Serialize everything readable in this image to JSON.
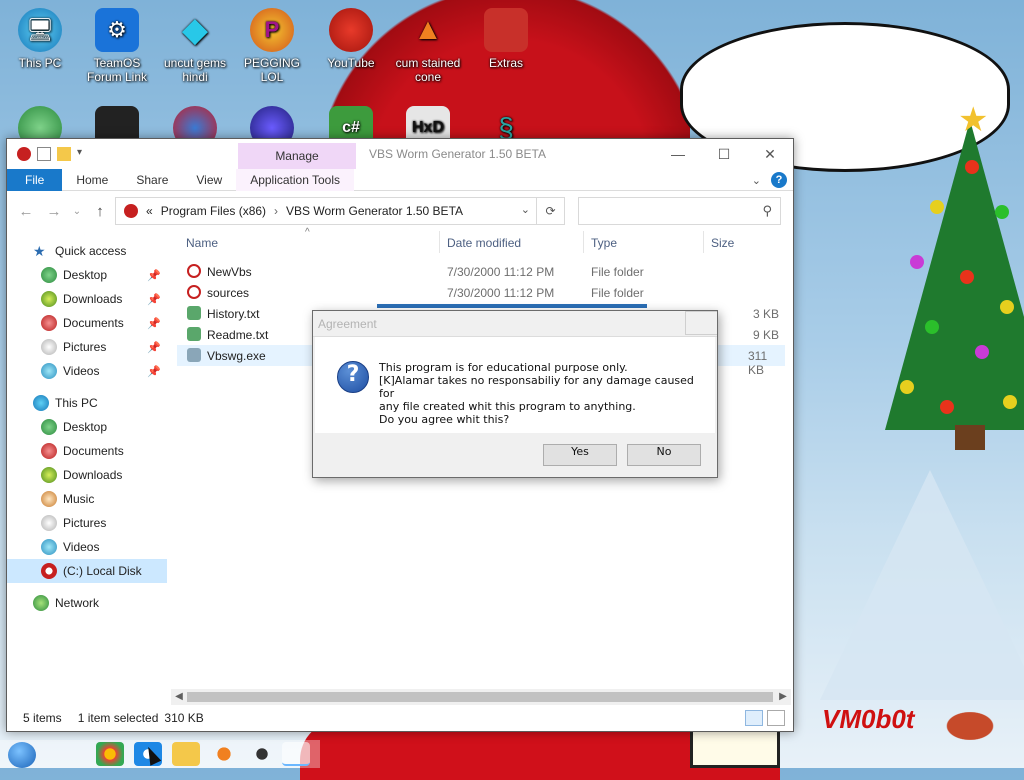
{
  "desktop": {
    "icons": [
      {
        "label": "This PC"
      },
      {
        "label": "TeamOS Forum Link"
      },
      {
        "label": "uncut gems hindi"
      },
      {
        "label": "PEGGING LOL"
      },
      {
        "label": "YouTube"
      },
      {
        "label": "cum stained cone"
      },
      {
        "label": "Extras"
      }
    ],
    "row2_icons": [
      {
        "label": ""
      },
      {
        "label": ""
      },
      {
        "label": ""
      },
      {
        "label": ""
      },
      {
        "label": "c#"
      },
      {
        "label": "HxD"
      },
      {
        "label": ""
      }
    ]
  },
  "wallpaper": {
    "speech_bubble": {},
    "signature": "VM0b0t"
  },
  "explorer": {
    "manage_tab": "Manage",
    "title": "VBS Worm Generator 1.50 BETA",
    "window_controls": {
      "minimize": "—",
      "maximize": "☐",
      "close": "✕"
    },
    "ribbon": {
      "file": "File",
      "home": "Home",
      "share": "Share",
      "view": "View",
      "app_tools": "Application Tools"
    },
    "address": {
      "prefix": "«",
      "crumbs": [
        "Program Files (x86)",
        "VBS Worm Generator 1.50 BETA"
      ],
      "separator": "›"
    },
    "search_placeholder": "",
    "nav": {
      "quick_access": "Quick access",
      "quick_items": [
        "Desktop",
        "Downloads",
        "Documents",
        "Pictures",
        "Videos"
      ],
      "this_pc": "This PC",
      "pc_items": [
        "Desktop",
        "Documents",
        "Downloads",
        "Music",
        "Pictures",
        "Videos",
        "(C:) Local Disk"
      ],
      "network": "Network"
    },
    "columns": {
      "name": "Name",
      "date": "Date modified",
      "type": "Type",
      "size": "Size"
    },
    "files": [
      {
        "name": "NewVbs",
        "date": "7/30/2000 11:12 PM",
        "type": "File folder",
        "size": ""
      },
      {
        "name": "sources",
        "date": "7/30/2000 11:12 PM",
        "type": "File folder",
        "size": ""
      },
      {
        "name": "History.txt",
        "date": "",
        "type": "",
        "size": "3 KB"
      },
      {
        "name": "Readme.txt",
        "date": "",
        "type": "",
        "size": "9 KB"
      },
      {
        "name": "Vbswg.exe",
        "date": "",
        "type": "",
        "size": "311 KB"
      }
    ],
    "status": {
      "items": "5 items",
      "selected": "1 item selected",
      "size": "310 KB"
    }
  },
  "dialog": {
    "title": "Agreement",
    "icon": "question-icon",
    "message_lines": [
      "This program is for educational purpose only.",
      "[K]Alamar takes no responsabiliy for any damage caused for",
      "any file created whit this program to anything.",
      "Do you agree whit this?"
    ],
    "yes": "Yes",
    "no": "No"
  },
  "colors": {
    "accent": "#1979ca",
    "manage_tab": "#f0d7f7",
    "selection": "#cce8ff",
    "signature": "#cf1010"
  }
}
